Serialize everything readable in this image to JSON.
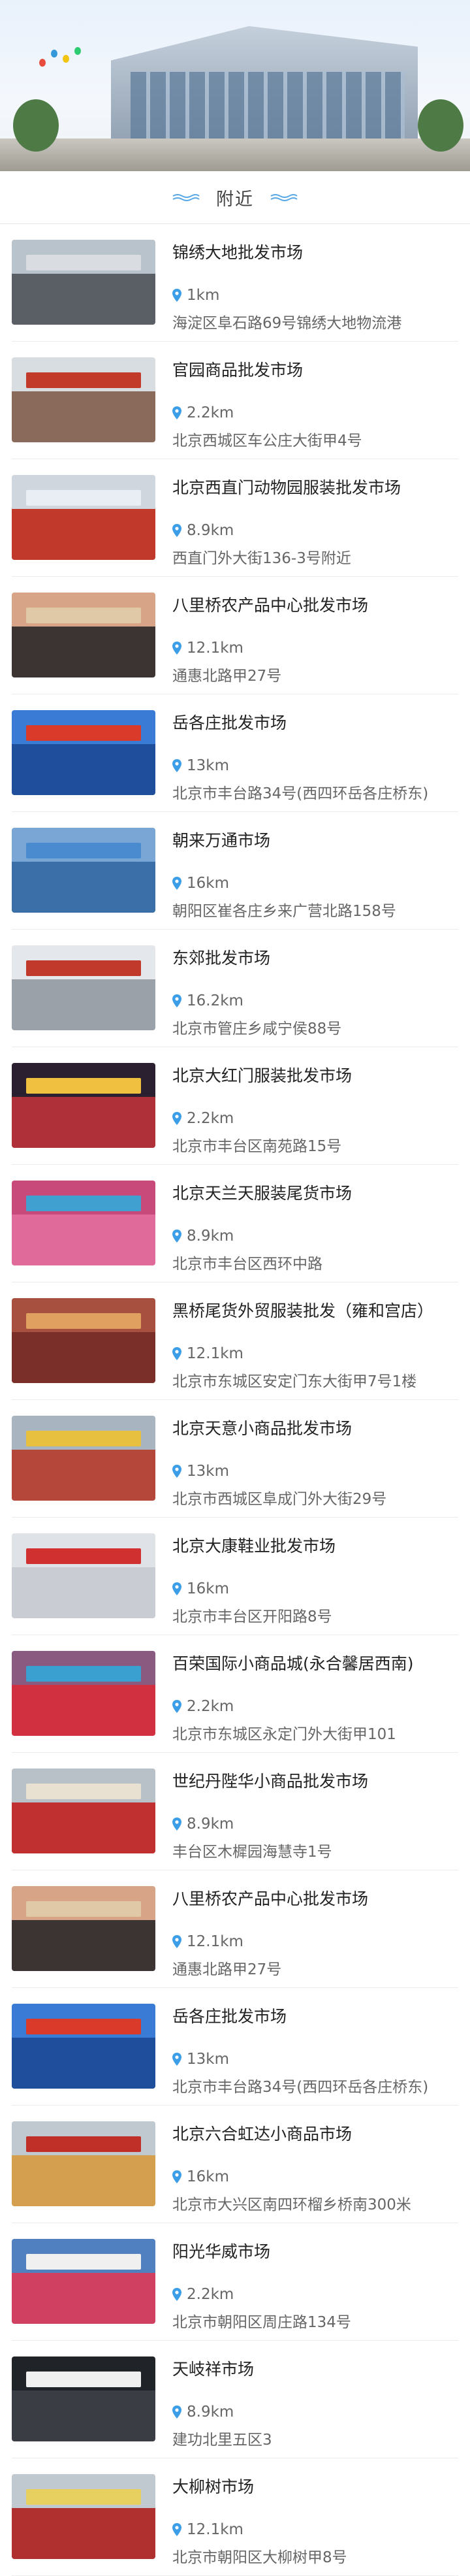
{
  "section": {
    "title": "附近"
  },
  "colors": {
    "pin": "#3d9ee8",
    "wave": "#5aa9e6"
  },
  "items": [
    {
      "name": "锦绣大地批发市场",
      "distance": "1km",
      "address": "海淀区阜石路69号锦绣大地物流港",
      "thumb": {
        "sky": "#b9c3cc",
        "bldg": "#5a5f66",
        "sign": "#d9dde2"
      }
    },
    {
      "name": "官园商品批发市场",
      "distance": "2.2km",
      "address": "北京西城区车公庄大街甲4号",
      "thumb": {
        "sky": "#d8dde2",
        "bldg": "#8a6a5a",
        "sign": "#c23a2a"
      }
    },
    {
      "name": "北京西直门动物园服装批发市场",
      "distance": "8.9km",
      "address": "西直门外大街136-3号附近",
      "thumb": {
        "sky": "#cfd6dd",
        "bldg": "#c0392b",
        "sign": "#e8eef4"
      }
    },
    {
      "name": "八里桥农产品中心批发市场",
      "distance": "12.1km",
      "address": "通惠北路甲27号",
      "thumb": {
        "sky": "#d7a488",
        "bldg": "#3b3432",
        "sign": "#e0c9a6"
      }
    },
    {
      "name": "岳各庄批发市场",
      "distance": "13km",
      "address": "北京市丰台路34号(西四环岳各庄桥东)",
      "thumb": {
        "sky": "#3a7bd5",
        "bldg": "#1f4e9c",
        "sign": "#d93a2a"
      }
    },
    {
      "name": "朝来万通市场",
      "distance": "16km",
      "address": "朝阳区崔各庄乡来广营北路158号",
      "thumb": {
        "sky": "#7aa6d6",
        "bldg": "#3b6fa8",
        "sign": "#4a8bd0"
      }
    },
    {
      "name": "东郊批发市场",
      "distance": "16.2km",
      "address": "北京市管庄乡咸宁侯88号",
      "thumb": {
        "sky": "#e4e8ec",
        "bldg": "#9aa1a8",
        "sign": "#c0392b"
      }
    },
    {
      "name": "北京大红门服装批发市场",
      "distance": "2.2km",
      "address": "北京市丰台区南苑路15号",
      "thumb": {
        "sky": "#2a2030",
        "bldg": "#b0303a",
        "sign": "#f0c040"
      }
    },
    {
      "name": "北京天兰天服装尾货市场",
      "distance": "8.9km",
      "address": "北京市丰台区西环中路",
      "thumb": {
        "sky": "#c84a7a",
        "bldg": "#e06a9a",
        "sign": "#40a0d0"
      }
    },
    {
      "name": "黑桥尾货外贸服装批发（雍和宫店）",
      "distance": "12.1km",
      "address": "北京市东城区安定门东大街甲7号1楼",
      "thumb": {
        "sky": "#a85040",
        "bldg": "#7a3028",
        "sign": "#e0a060"
      }
    },
    {
      "name": "北京天意小商品批发市场",
      "distance": "13km",
      "address": "北京市西城区阜成门外大街29号",
      "thumb": {
        "sky": "#a8b4c0",
        "bldg": "#b5473a",
        "sign": "#e8c040"
      }
    },
    {
      "name": "北京大康鞋业批发市场",
      "distance": "16km",
      "address": "北京市丰台区开阳路8号",
      "thumb": {
        "sky": "#dfe3e8",
        "bldg": "#c9ccd2",
        "sign": "#d03030"
      }
    },
    {
      "name": "百荣国际小商品城(永合馨居西南)",
      "distance": "2.2km",
      "address": "北京市东城区永定门外大街甲101",
      "thumb": {
        "sky": "#8a5a80",
        "bldg": "#d03040",
        "sign": "#3aa0d0"
      }
    },
    {
      "name": "世纪丹陛华小商品批发市场",
      "distance": "8.9km",
      "address": "丰台区木樨园海慧寺1号",
      "thumb": {
        "sky": "#b8c0c8",
        "bldg": "#c03030",
        "sign": "#e8e0d0"
      }
    },
    {
      "name": "八里桥农产品中心批发市场",
      "distance": "12.1km",
      "address": "通惠北路甲27号",
      "thumb": {
        "sky": "#d7a488",
        "bldg": "#3b3432",
        "sign": "#e0c9a6"
      }
    },
    {
      "name": "岳各庄批发市场",
      "distance": "13km",
      "address": "北京市丰台路34号(西四环岳各庄桥东)",
      "thumb": {
        "sky": "#3a7bd5",
        "bldg": "#1f4e9c",
        "sign": "#d93a2a"
      }
    },
    {
      "name": "北京六合虹达小商品市场",
      "distance": "16km",
      "address": "北京市大兴区南四环榴乡桥南300米",
      "thumb": {
        "sky": "#c0c8d0",
        "bldg": "#d4a050",
        "sign": "#c03028"
      }
    },
    {
      "name": "阳光华威市场",
      "distance": "2.2km",
      "address": "北京市朝阳区周庄路134号",
      "thumb": {
        "sky": "#5080c0",
        "bldg": "#d04060",
        "sign": "#f0f0f0"
      }
    },
    {
      "name": "天岐祥市场",
      "distance": "8.9km",
      "address": "建功北里五区3",
      "thumb": {
        "sky": "#202428",
        "bldg": "#3a3e44",
        "sign": "#f0f0f0"
      }
    },
    {
      "name": "大柳树市场",
      "distance": "12.1km",
      "address": "北京市朝阳区大柳树甲8号",
      "thumb": {
        "sky": "#c0c8d0",
        "bldg": "#b03030",
        "sign": "#e8d060"
      }
    }
  ]
}
